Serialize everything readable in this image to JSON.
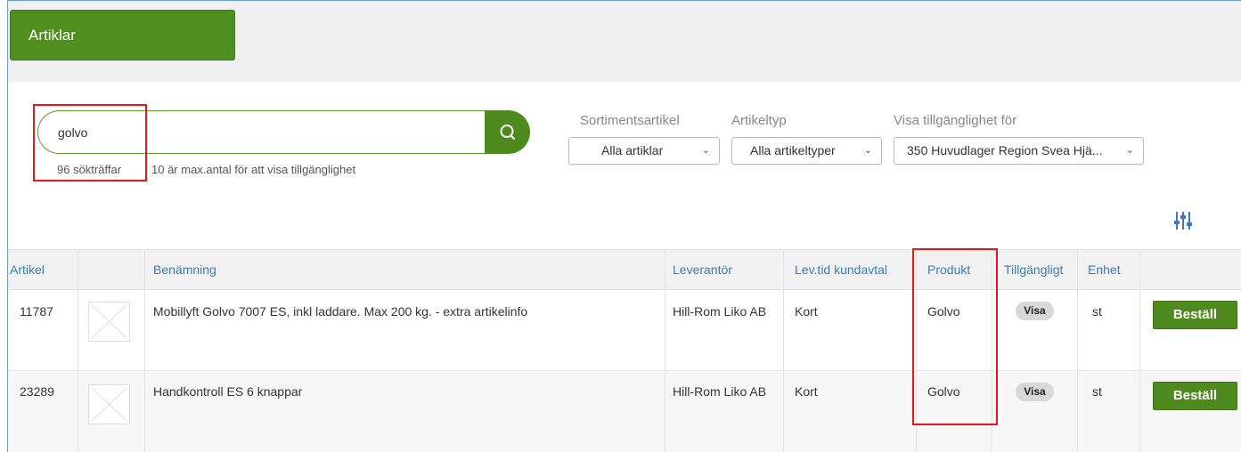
{
  "tab": {
    "label": "Artiklar"
  },
  "search": {
    "value": "golvo",
    "hits": "96 sökträffar",
    "note": "10 är max.antal för att visa tillgänglighet"
  },
  "filters": {
    "sortiment": {
      "label": "Sortimentsartikel",
      "value": "Alla artiklar"
    },
    "artikeltyp": {
      "label": "Artikeltyp",
      "value": "Alla artikeltyper"
    },
    "tillganglighet": {
      "label": "Visa tillgänglighet för",
      "value": "350 Huvudlager Region Svea Hjä..."
    }
  },
  "table": {
    "headers": {
      "artikel": "Artikel",
      "benamning": "Benämning",
      "leverantor": "Leverantör",
      "levtid": "Lev.tid kundavtal",
      "produkt": "Produkt",
      "tillgangligt": "Tillgängligt",
      "enhet": "Enhet"
    },
    "rows": [
      {
        "artikel": "11787",
        "benamning": "Mobillyft Golvo 7007 ES, inkl laddare. Max 200 kg. - extra artikelinfo",
        "leverantor": "Hill-Rom Liko AB",
        "levtid": "Kort",
        "produkt": "Golvo",
        "tillgangligt": "Visa",
        "enhet": "st",
        "order": "Beställ"
      },
      {
        "artikel": "23289",
        "benamning": "Handkontroll ES 6 knappar",
        "leverantor": "Hill-Rom Liko AB",
        "levtid": "Kort",
        "produkt": "Golvo",
        "tillgangligt": "Visa",
        "enhet": "st",
        "order": "Beställ"
      }
    ]
  },
  "colors": {
    "brand_green": "#4e8f20",
    "link_blue": "#3a7bbf",
    "highlight_red": "#e8161b"
  }
}
